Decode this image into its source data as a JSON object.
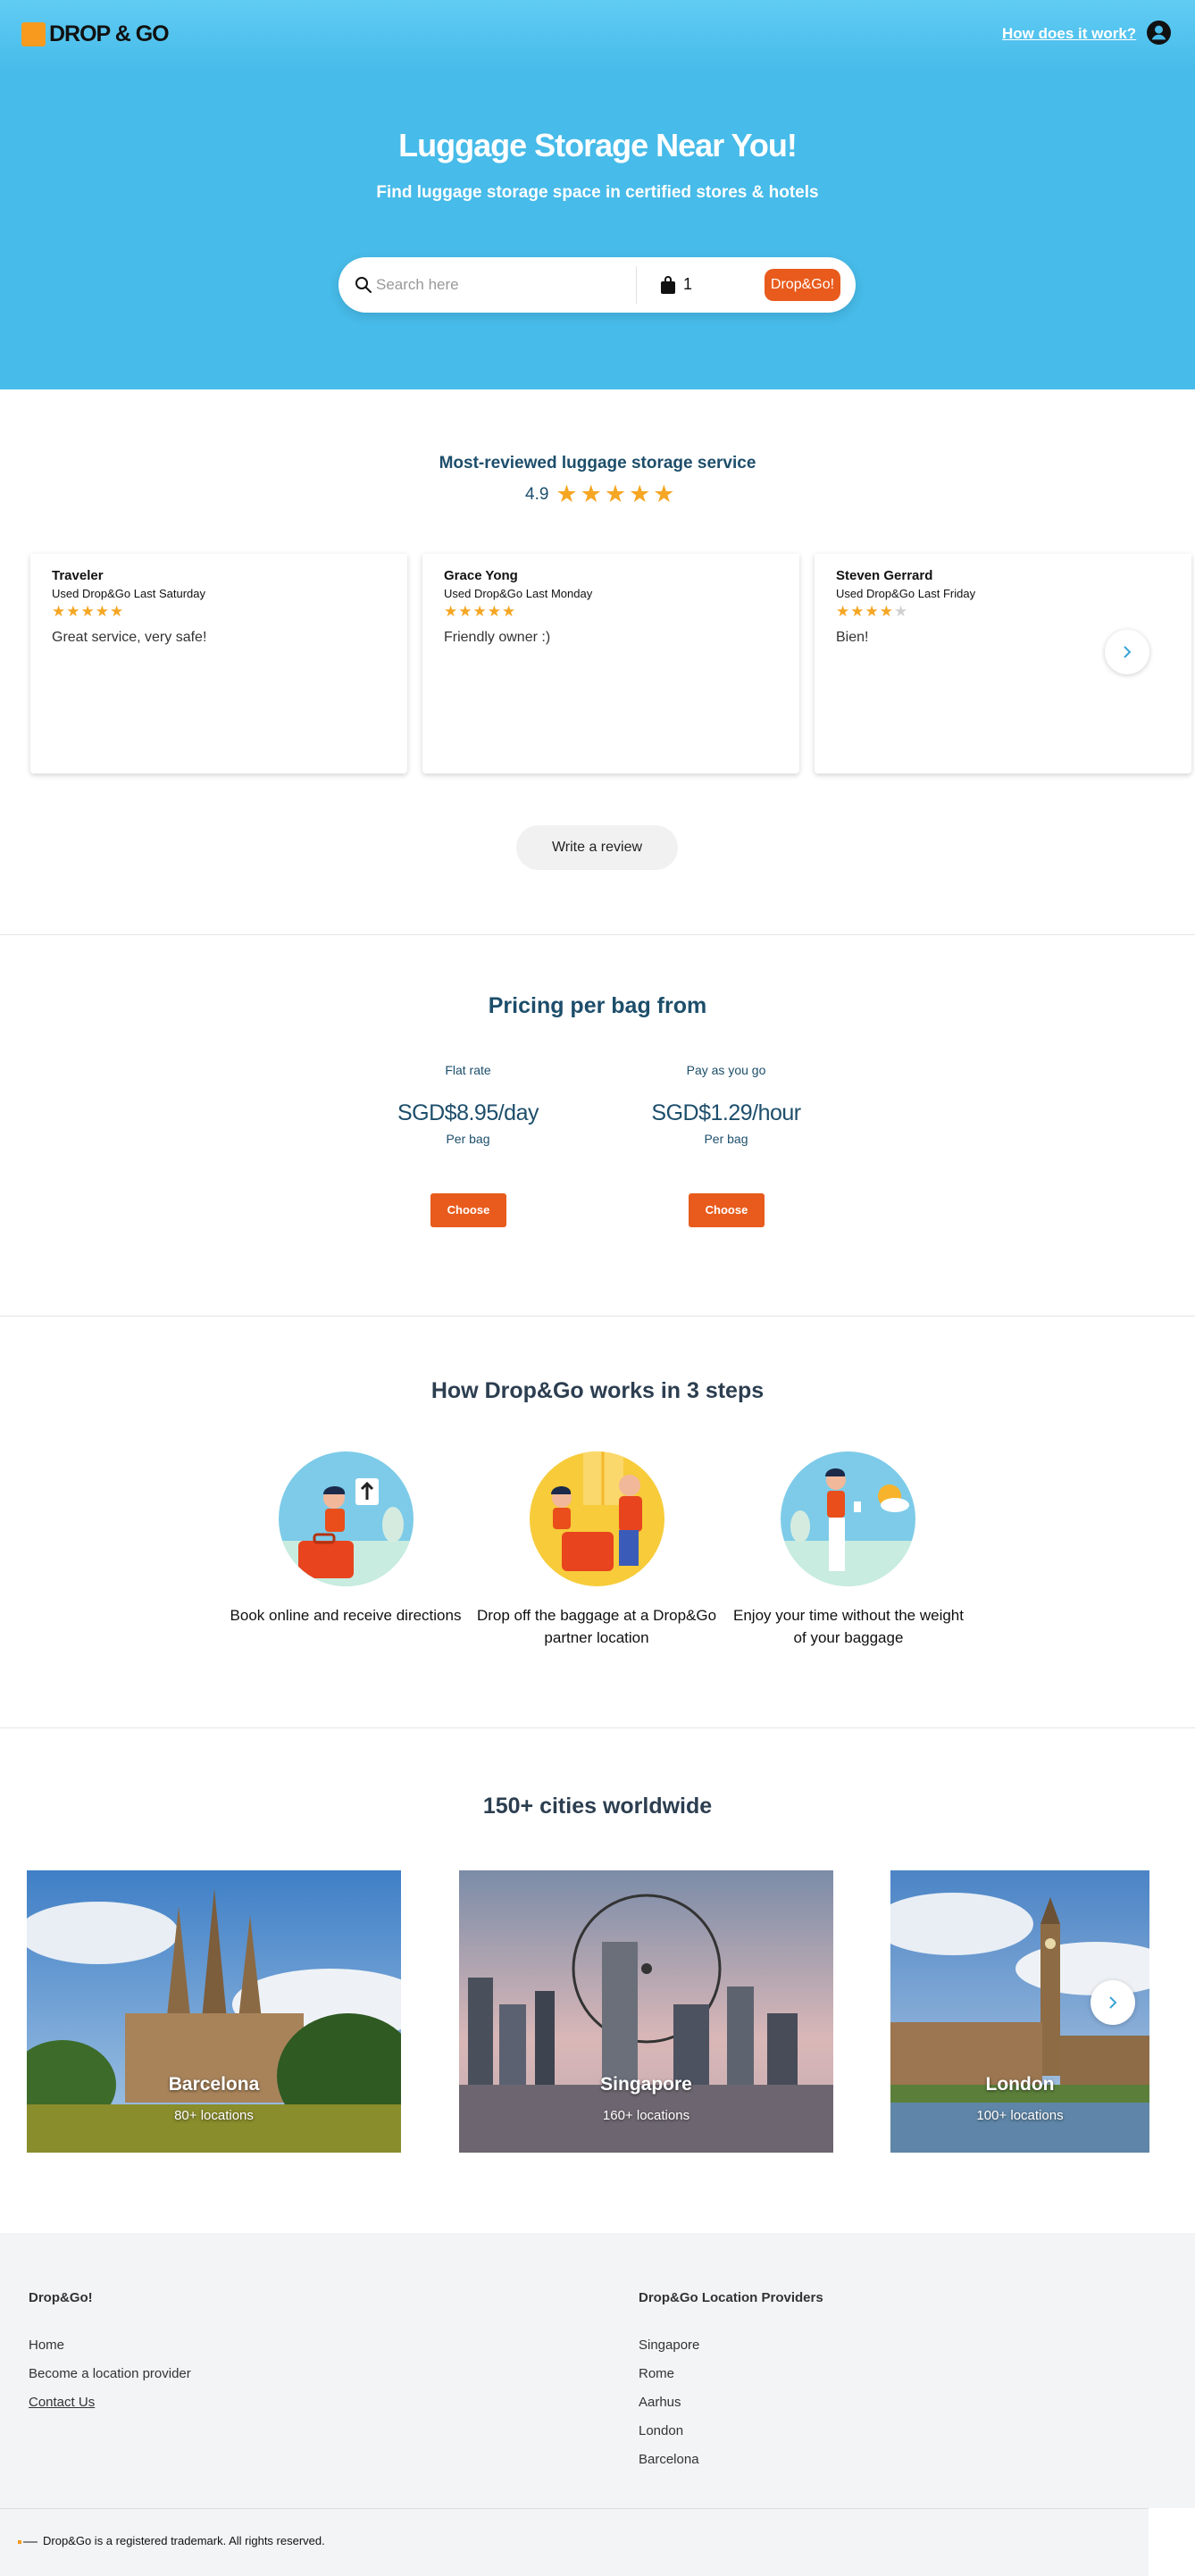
{
  "header": {
    "logo_text": "DROP & GO",
    "how_link": "How does it work?",
    "title": "Luggage Storage Near You!",
    "subtitle": "Find luggage storage space in certified stores & hotels"
  },
  "search": {
    "placeholder": "Search here",
    "bag_count": "1",
    "button_label": "Drop&Go!"
  },
  "reviews": {
    "heading": "Most-reviewed luggage storage service",
    "rating": "4.9",
    "rating_stars": 5,
    "cards": [
      {
        "name": "Traveler",
        "used": "Used Drop&Go Last Saturday",
        "stars": 5,
        "text": "Great service, very safe!"
      },
      {
        "name": "Grace Yong",
        "used": "Used Drop&Go Last Monday",
        "stars": 5,
        "text": "Friendly owner :)"
      },
      {
        "name": "Steven Gerrard",
        "used": "Used Drop&Go Last Friday",
        "stars": 4,
        "text": "Bien!"
      }
    ],
    "write_review": "Write a review"
  },
  "pricing": {
    "title": "Pricing per bag from",
    "plans": [
      {
        "label": "Flat rate",
        "price": "SGD$8.95/day",
        "per": "Per bag",
        "button": "Choose"
      },
      {
        "label": "Pay as you go",
        "price": "SGD$1.29/hour",
        "per": "Per bag",
        "button": "Choose"
      }
    ]
  },
  "steps": {
    "title": "How Drop&Go works in 3 steps",
    "items": [
      {
        "text": "Book online and receive directions"
      },
      {
        "text": "Drop off the baggage at a Drop&Go partner location"
      },
      {
        "text": "Enjoy your time without the weight of your baggage"
      }
    ]
  },
  "cities": {
    "title": "150+ cities worldwide",
    "items": [
      {
        "name": "Barcelona",
        "count": "80+ locations"
      },
      {
        "name": "Singapore",
        "count": "160+ locations"
      },
      {
        "name": "London",
        "count": "100+ locations"
      }
    ]
  },
  "footer": {
    "col1": {
      "heading": "Drop&Go!",
      "links": [
        "Home",
        "Become a location provider",
        "Contact Us"
      ]
    },
    "col2": {
      "heading": "Drop&Go Location Providers",
      "links": [
        "Singapore",
        "Rome",
        "Aarhus",
        "London",
        "Barcelona"
      ]
    },
    "copyright": "Drop&Go is a registered trademark. All rights reserved."
  },
  "colors": {
    "hero": "#47bbe9",
    "accent": "#e85b1c",
    "heading": "#1d4e6b",
    "star": "#f5a623"
  }
}
